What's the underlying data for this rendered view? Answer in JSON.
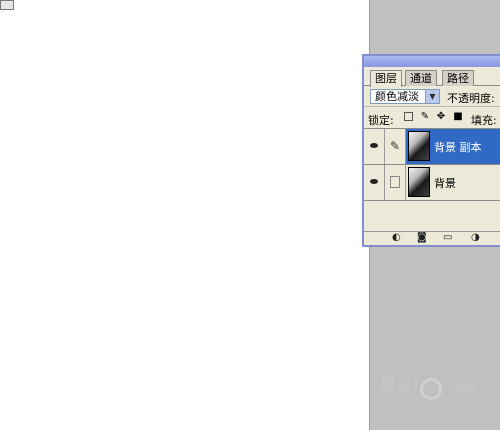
{
  "panel": {
    "tabs": [
      {
        "label": "图层"
      },
      {
        "label": "通道"
      },
      {
        "label": "路径"
      }
    ],
    "blend_mode": "颜色减淡",
    "opacity_label": "不透明度:",
    "lock_label": "锁定:",
    "fill_label": "填充:",
    "layers": [
      {
        "name": "背景 副本",
        "selected": true
      },
      {
        "name": "背景",
        "selected": false
      }
    ]
  },
  "icons": {
    "eye": "eye-icon",
    "brush": "brush-icon",
    "lock_transparent": "lock-transparent-icon",
    "lock_paint": "lock-paint-icon",
    "lock_move": "lock-move-icon",
    "lock_all": "lock-all-icon",
    "link_layers": "link-layers-icon",
    "layer_style": "layer-style-icon",
    "mask": "mask-icon",
    "folder": "folder-icon",
    "adjustment": "adjustment-layer-icon"
  },
  "colors": {
    "selected_layer": "#316ac5",
    "panel_bg": "#ece9d8",
    "workspace_gray": "#c0c0c0",
    "panel_border": "#7f8fd0"
  },
  "watermark": {
    "brand": "Bai",
    "brand_cn": "经验",
    "url": "jingyan.baidu.com"
  }
}
